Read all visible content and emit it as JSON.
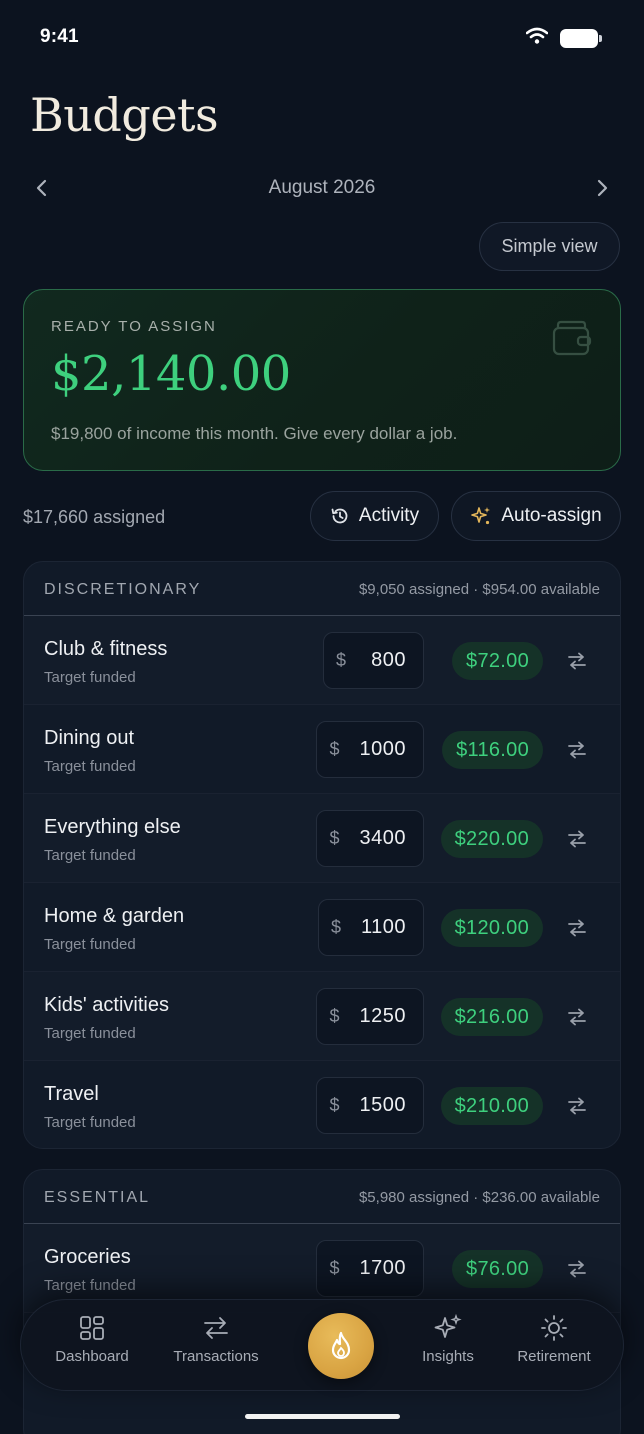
{
  "status_bar": {
    "time": "9:41"
  },
  "header": {
    "title": "Budgets"
  },
  "month_nav": {
    "label": "August 2026"
  },
  "view_toggle": {
    "label": "Simple view"
  },
  "ready_card": {
    "label": "READY TO ASSIGN",
    "amount": "$2,140.00",
    "note": "$19,800 of income this month. Give every dollar a job."
  },
  "summary": {
    "assigned": "$17,660 assigned",
    "activity_label": "Activity",
    "auto_assign_label": "Auto-assign"
  },
  "groups": [
    {
      "name": "DISCRETIONARY",
      "meta": "$9,050 assigned · $954.00 available",
      "rows": [
        {
          "name": "Club & fitness",
          "status": "Target funded",
          "currency": "$",
          "assigned": "800",
          "available": "$72.00"
        },
        {
          "name": "Dining out",
          "status": "Target funded",
          "currency": "$",
          "assigned": "1000",
          "available": "$116.00"
        },
        {
          "name": "Everything else",
          "status": "Target funded",
          "currency": "$",
          "assigned": "3400",
          "available": "$220.00"
        },
        {
          "name": "Home & garden",
          "status": "Target funded",
          "currency": "$",
          "assigned": "1100",
          "available": "$120.00"
        },
        {
          "name": "Kids' activities",
          "status": "Target funded",
          "currency": "$",
          "assigned": "1250",
          "available": "$216.00"
        },
        {
          "name": "Travel",
          "status": "Target funded",
          "currency": "$",
          "assigned": "1500",
          "available": "$210.00"
        }
      ]
    },
    {
      "name": "ESSENTIAL",
      "meta": "$5,980 assigned · $236.00 available",
      "rows": [
        {
          "name": "Groceries",
          "status": "Target funded",
          "currency": "$",
          "assigned": "1700",
          "available": "$76.00"
        }
      ]
    }
  ],
  "tab_bar": {
    "dashboard": "Dashboard",
    "transactions": "Transactions",
    "insights": "Insights",
    "retirement": "Retirement",
    "center_icon": "flame-icon"
  },
  "colors": {
    "background": "#0c131f",
    "accent_green": "#3ed07e",
    "accent_gold": "#d9a443",
    "card_border_green": "#2a6b48"
  }
}
